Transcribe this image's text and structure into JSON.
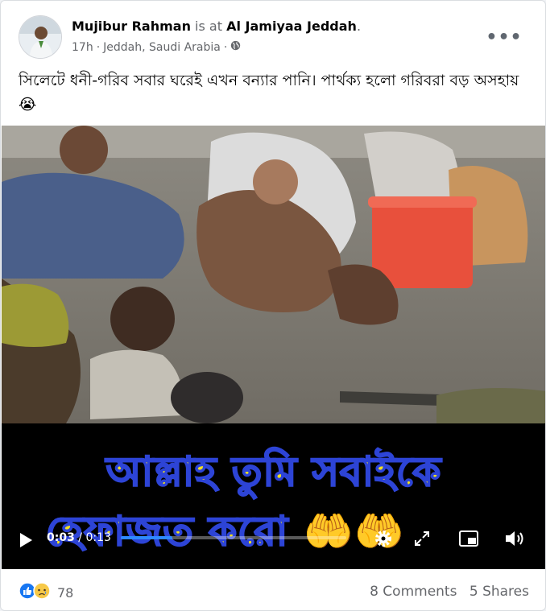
{
  "post": {
    "author": "Mujibur Rahman",
    "is_at": "is at",
    "place": "Al Jamiyaa Jeddah",
    "period": ".",
    "time": "17h",
    "separator": "·",
    "location": "Jeddah, Saudi Arabia",
    "separator2": "·",
    "privacy_icon": "globe-icon",
    "more_icon": "more-options-icon",
    "more_label": "•••",
    "text": "সিলেটে ধনী-গরিব সবার ঘরেই এখন বন্যার পানি। পার্থক্য হলো গরিবরা বড় অসহায় 😭"
  },
  "video": {
    "caption_line1": "আল্লাহ তুমি সবাইকে",
    "caption_line2": "হেফাজত করো 🤲🤲",
    "current_time": "0:03",
    "time_separator": "/",
    "duration": "0:13",
    "progress": 0.23,
    "controls": [
      "play-icon",
      "settings-icon",
      "fullscreen-icon",
      "pip-icon",
      "volume-icon"
    ]
  },
  "engagement": {
    "reaction_icons": [
      "like-icon",
      "sad-icon"
    ],
    "reactions_count": "78",
    "comments": "8 Comments",
    "shares": "5 Shares"
  },
  "colors": {
    "link_blue": "#2e89ff",
    "caption_yellow": "#f4e21e",
    "caption_outline": "#2d44d6",
    "meta_gray": "#65676b"
  }
}
